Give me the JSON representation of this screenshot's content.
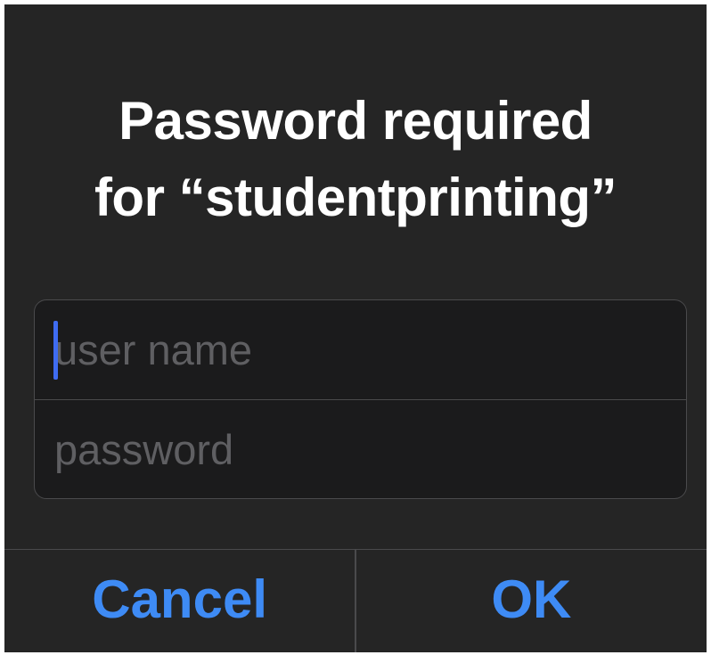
{
  "dialog": {
    "title_line1": "Password required",
    "title_line2": "for “studentprinting”",
    "username": {
      "value": "",
      "placeholder": "user name"
    },
    "password": {
      "value": "",
      "placeholder": "password"
    },
    "cancel_label": "Cancel",
    "ok_label": "OK"
  },
  "colors": {
    "background": "#252525",
    "accent": "#3e8bf5",
    "cursor": "#3f6cf2"
  }
}
